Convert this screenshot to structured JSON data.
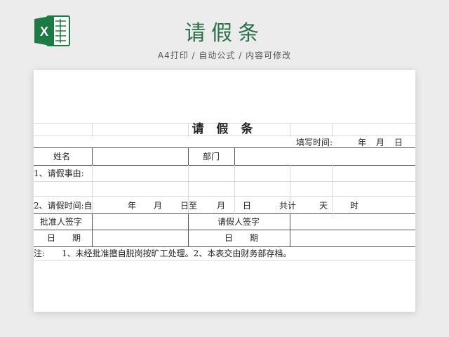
{
  "banner": {
    "title": "请假条",
    "subtitle": "A4打印 / 自动公式 / 内容可修改",
    "logo_letter": "X",
    "logo_icon": "excel-icon",
    "accent_color": "#2e6e4c",
    "logo_color": "#1d7a44"
  },
  "form": {
    "title": "请 假 条",
    "fill_time_label": "填写时间:",
    "year": "年",
    "month": "月",
    "day": "日",
    "name_label": "姓名",
    "dept_label": "部门",
    "reason_label": "1、请假事由:",
    "time_row": {
      "label": "2、请假时间:自",
      "year": "年",
      "month": "月",
      "day_to": "日至",
      "month2": "月",
      "day2": "日",
      "total": "共计",
      "days": "天",
      "hours": "时"
    },
    "approver_sign": "批准人签字",
    "applicant_sign": "请假人签字",
    "date_left": "日　　期",
    "date_right": "日　　期",
    "note": "注:　　1、未经批准擅自脱岗按旷工处理。2、本表交由财务部存档。"
  }
}
